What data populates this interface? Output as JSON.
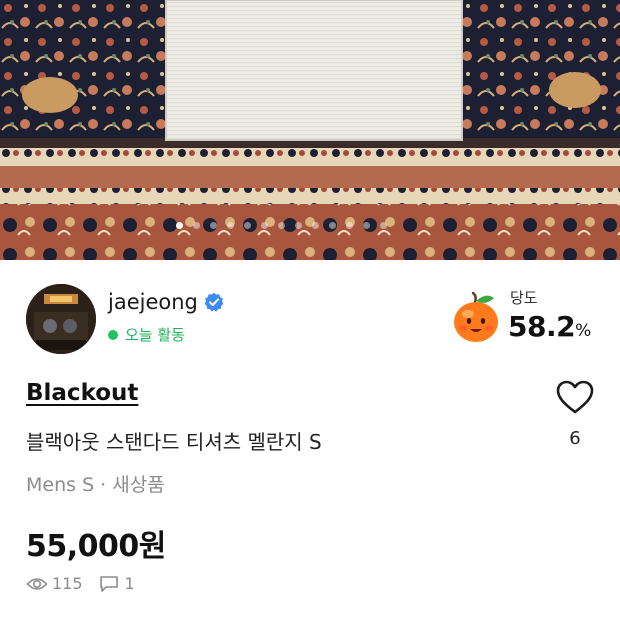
{
  "carousel": {
    "slide_count": 13,
    "active_index": 0
  },
  "seller": {
    "username": "jaejeong",
    "verified_icon": "verified-check-icon",
    "activity_status": "오늘 활동",
    "activity_color": "#21c25f"
  },
  "manner_temperature": {
    "label": "당도",
    "value": "58.2",
    "unit": "%",
    "icon": "peach-icon"
  },
  "product": {
    "brand": "Blackout",
    "title": "블랙아웃 스탠다드 티셔츠 멜란지 S",
    "meta": "Mens S · 새상품",
    "price": "55,000원"
  },
  "stats": {
    "views": "115",
    "comments": "1"
  },
  "like": {
    "count": "6",
    "icon": "heart-outline-icon"
  }
}
